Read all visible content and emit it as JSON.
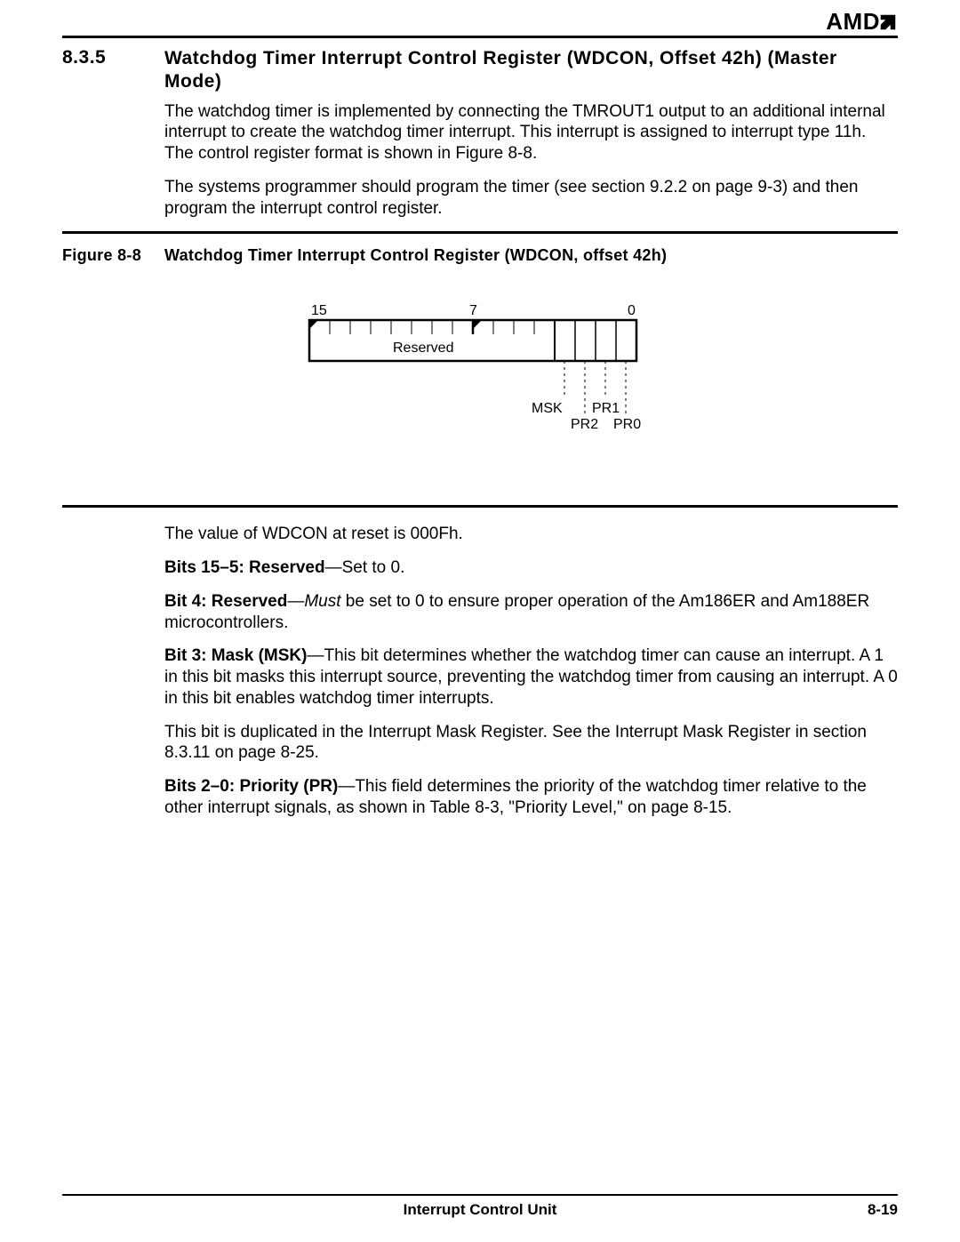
{
  "brand": "AMD",
  "section": {
    "number": "8.3.5",
    "title": "Watchdog Timer Interrupt Control Register (WDCON, Offset 42h) (Master Mode)"
  },
  "para1": "The watchdog timer is implemented by connecting the TMROUT1 output to an additional internal interrupt to create the watchdog timer interrupt. This interrupt is assigned to interrupt type 11h. The control register format is shown in Figure 8-8.",
  "para2": "The systems programmer should program the timer (see section 9.2.2 on page 9-3) and then program the interrupt control register.",
  "figure": {
    "number": "Figure 8-8",
    "title": "Watchdog Timer Interrupt Control Register (WDCON, offset 42h)"
  },
  "chart_data": {
    "type": "table",
    "bit_high": "15",
    "bit_mid": "7",
    "bit_low": "0",
    "reserved_label": "Reserved",
    "fields": [
      {
        "name": "MSK",
        "bit": 3
      },
      {
        "name": "PR2",
        "bit": 2
      },
      {
        "name": "PR1",
        "bit": 1
      },
      {
        "name": "PR0",
        "bit": 0
      }
    ]
  },
  "para3": "The value of WDCON at reset is 000Fh.",
  "para4_bold": "Bits 15–5: Reserved",
  "para4_rest": "—Set to 0.",
  "para5_bold": "Bit 4: Reserved",
  "para5_dash": "—",
  "para5_ital": "Must",
  "para5_rest": " be set to 0 to ensure proper operation of the Am186ER and Am188ER microcontrollers.",
  "para6_bold": "Bit 3: Mask (MSK)",
  "para6_rest": "—This bit determines whether the watchdog timer can cause an interrupt. A 1 in this bit masks this interrupt source, preventing the watchdog timer from causing an interrupt. A 0 in this bit enables watchdog timer interrupts.",
  "para7": "This bit is duplicated in the Interrupt Mask Register. See the Interrupt Mask Register in section 8.3.11 on page 8-25.",
  "para8_bold": "Bits 2–0: Priority (PR)",
  "para8_rest": "—This field determines the priority of the watchdog timer relative to the other interrupt signals, as shown in Table 8-3, \"Priority Level,\" on page 8-15.",
  "footer_title": "Interrupt Control Unit",
  "footer_page": "8-19"
}
